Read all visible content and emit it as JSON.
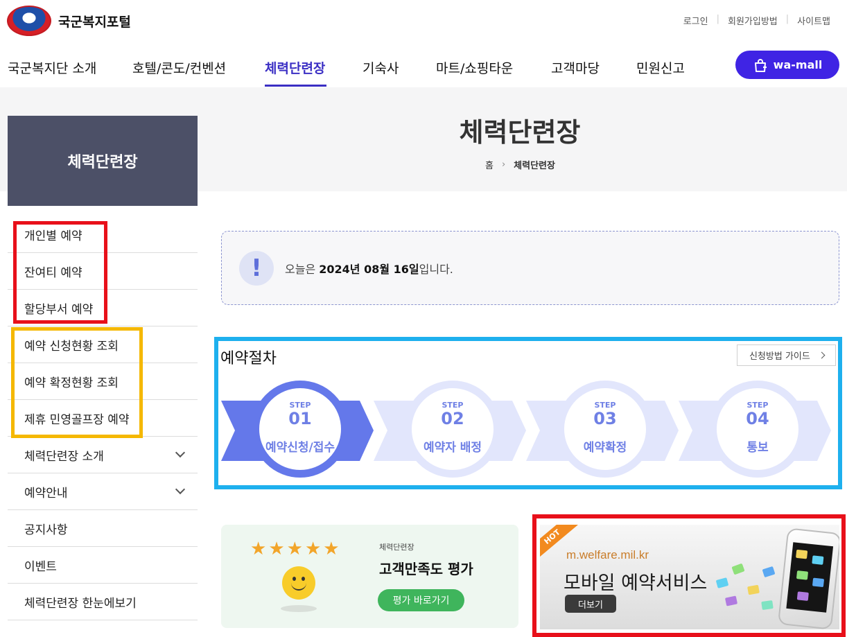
{
  "header": {
    "logo_text": "국군복지포털",
    "util_links": [
      "로그인",
      "회원가입방법",
      "사이트맵"
    ],
    "util_separator": "|"
  },
  "gnb": {
    "items": [
      "국군복지단 소개",
      "호텔/콘도/컨벤션",
      "체력단련장",
      "기숙사",
      "마트/쇼핑타운",
      "고객마당",
      "민원신고"
    ],
    "active_index": 2,
    "wamall_label": "wa-mall"
  },
  "side": {
    "title": "체력단련장",
    "items": [
      {
        "label": "개인별 예약"
      },
      {
        "label": "잔여티 예약"
      },
      {
        "label": "할당부서 예약"
      },
      {
        "label": "예약 신청현황 조회"
      },
      {
        "label": "예약 확정현황 조회"
      },
      {
        "label": "제휴 민영골프장 예약"
      },
      {
        "label": "체력단련장 소개",
        "expandable": true
      },
      {
        "label": "예약안내",
        "expandable": true
      },
      {
        "label": "공지사항"
      },
      {
        "label": "이벤트"
      },
      {
        "label": "체력단련장 한눈에보기"
      }
    ]
  },
  "main": {
    "page_title": "체력단련장",
    "breadcrumb": {
      "home": "홈",
      "separator": "›",
      "current": "체력단련장"
    },
    "today": {
      "icon_text": "!",
      "prefix": "오늘은 ",
      "date": "2024년 08월 16일",
      "suffix": "입니다."
    },
    "procedure": {
      "title": "예약절차",
      "guide_button": "신청방법 가이드",
      "steps": [
        {
          "label": "STEP",
          "num": "01",
          "name": "예약신청/접수",
          "active": true
        },
        {
          "label": "STEP",
          "num": "02",
          "name": "예약자 배정",
          "active": false
        },
        {
          "label": "STEP",
          "num": "03",
          "name": "예약확정",
          "active": false
        },
        {
          "label": "STEP",
          "num": "04",
          "name": "통보",
          "active": false
        }
      ]
    },
    "survey": {
      "category": "체력단련장",
      "title": "고객만족도 평가",
      "button": "평가 바로가기",
      "stars": "★★★★★",
      "rating": 5
    },
    "banner": {
      "badge": "HOT",
      "url": "m.welfare.mil.kr",
      "title": "모바일 예약서비스",
      "button": "더보기"
    }
  },
  "colors": {
    "brand_purple": "#3f24e4",
    "step_blue": "#6478ea",
    "highlight_red": "#e8101a",
    "highlight_yellow": "#f5b800",
    "highlight_cyan": "#1eb0ee",
    "survey_green": "#3fb55c"
  }
}
